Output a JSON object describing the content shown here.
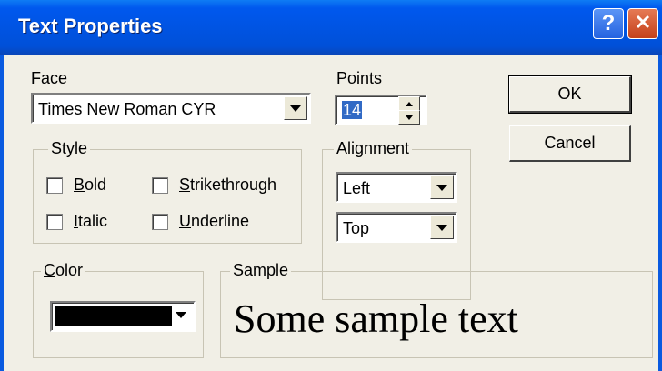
{
  "window": {
    "title": "Text Properties",
    "help_glyph": "?",
    "close_glyph": "✕"
  },
  "face": {
    "label_mnemonic": "F",
    "label_rest": "ace",
    "value": "Times New Roman CYR"
  },
  "style": {
    "legend": "Style",
    "bold": {
      "mnemonic": "B",
      "rest": "old"
    },
    "italic": {
      "mnemonic": "I",
      "rest": "talic"
    },
    "strikethrough": {
      "mnemonic": "S",
      "rest": "trikethrough"
    },
    "underline": {
      "mnemonic": "U",
      "rest": "nderline"
    }
  },
  "points": {
    "label_mnemonic": "P",
    "label_rest": "oints",
    "value": "14"
  },
  "alignment": {
    "legend_mnemonic": "A",
    "legend_rest": "lignment",
    "horizontal": "Left",
    "vertical": "Top"
  },
  "buttons": {
    "ok": "OK",
    "cancel": "Cancel"
  },
  "color": {
    "legend_mnemonic": "C",
    "legend_rest": "olor",
    "swatch": "#000000"
  },
  "sample": {
    "legend": "Sample",
    "text": "Some sample text"
  }
}
